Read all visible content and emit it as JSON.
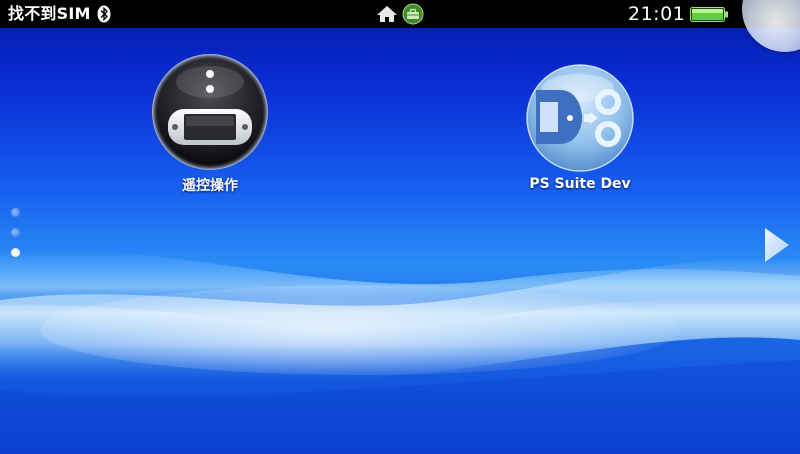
{
  "status_bar": {
    "carrier": "找不到SIM",
    "clock": "21:01",
    "icons": [
      "bluetooth-icon",
      "home-icon",
      "toolbox-icon",
      "battery-icon"
    ]
  },
  "home_screen": {
    "apps": [
      {
        "label": "遥控操作",
        "icon": "remote-play-icon"
      },
      {
        "label": "PS Suite Dev",
        "icon": "ps-suite-dev-icon"
      }
    ],
    "page_dots": {
      "count": 3,
      "active_index": 2
    }
  },
  "colors": {
    "status_bar_bg": "#000000",
    "background_top": "#0418a8",
    "background_mid": "#2b8cf5",
    "battery_green": "#5fd13a"
  }
}
